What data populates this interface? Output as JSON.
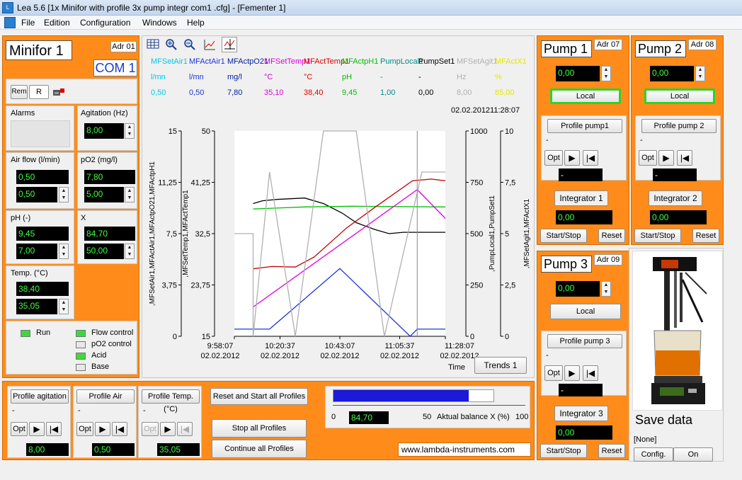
{
  "window": {
    "title": "Lea 5.6 [1x Minifor with profile 3x pump integr com1 .cfg] - [Fementer 1]"
  },
  "menu": [
    "File",
    "Edition",
    "Configuration",
    "Windows",
    "Help"
  ],
  "minifor": {
    "title": "Minifor 1",
    "adr": "Adr 01",
    "com": "COM 1",
    "tabs": [
      "Rem",
      "R"
    ],
    "alarms_label": "Alarms",
    "agitation": {
      "label": "Agitation (Hz)",
      "value": "8,00"
    },
    "airflow": {
      "label": "Air flow (l/min)",
      "actual": "0,50",
      "set": "0,50"
    },
    "po2": {
      "label": "pO2 (mg/l)",
      "actual": "7,80",
      "set": "5,00"
    },
    "ph": {
      "label": "pH (-)",
      "actual": "9,45",
      "set": "7,00"
    },
    "x": {
      "label": "X",
      "actual": "84,70",
      "set": "50,00"
    },
    "temp": {
      "label": "Temp. (°C)",
      "actual": "38,40",
      "set": "35,05"
    },
    "run": "Run",
    "status": [
      {
        "label": "Flow control",
        "on": true
      },
      {
        "label": "pO2 control",
        "on": false
      },
      {
        "label": "Acid",
        "on": true
      },
      {
        "label": "Base",
        "on": false
      }
    ]
  },
  "trend": {
    "channels": [
      {
        "name": "MFSetAir1",
        "unit": "l/mn",
        "value": "0,50",
        "color": "#00c8e6"
      },
      {
        "name": "MFActAir1",
        "unit": "l/mn",
        "value": "0,50",
        "color": "#1b36e0"
      },
      {
        "name": "MFActpO21",
        "unit": "mg/l",
        "value": "7,80",
        "color": "#001f9f"
      },
      {
        "name": "MFSetTemp1",
        "unit": "°C",
        "value": "35,10",
        "color": "#e000e0"
      },
      {
        "name": "MFActTemp1",
        "unit": "°C",
        "value": "38,40",
        "color": "#e00000"
      },
      {
        "name": "MFActpH1",
        "unit": "pH",
        "value": "9,45",
        "color": "#00c000"
      },
      {
        "name": "PumpLocal1",
        "unit": "-",
        "value": "1,00",
        "color": "#008b8b"
      },
      {
        "name": "PumpSet1",
        "unit": "-",
        "value": "0,00",
        "color": "#000000"
      },
      {
        "name": "MFSetAgit1",
        "unit": "Hz",
        "value": "8,00",
        "color": "#b0b0b0"
      },
      {
        "name": "MFActX1",
        "unit": "%",
        "value": "85,00",
        "color": "#e6e600"
      }
    ],
    "timestamp": "02.02.201211:28:07",
    "button": "Trends 1",
    "time_label": "Time",
    "chart_data": {
      "type": "line",
      "axes": {
        "y1": {
          "label": ",MFSetAir1,MFActAir1,MFActpO21,MFActpH1",
          "ticks": [
            "15",
            "11,25",
            "7,5",
            "3,75",
            "0"
          ],
          "range": [
            0,
            15
          ]
        },
        "y2": {
          "label": ",MFSetTemp1,MFActTemp1",
          "ticks": [
            "50",
            "41,25",
            "32,5",
            "23,75",
            "15"
          ],
          "range": [
            15,
            50
          ]
        },
        "y3": {
          "label": ",PumpLocal1,PumpSet1",
          "ticks": [
            "1000",
            "750",
            "500",
            "250",
            "0"
          ],
          "range": [
            0,
            1000
          ]
        },
        "y4": {
          "label": ",MFSetAgit1,MFActX1",
          "ticks": [
            "10",
            "7,5",
            "5",
            "2,5",
            "0"
          ],
          "range": [
            0,
            10
          ]
        }
      },
      "x_ticks": [
        {
          "time": "9:58:07",
          "date": "02.02.2012"
        },
        {
          "time": "10:20:37",
          "date": "02.02.2012"
        },
        {
          "time": "10:43:07",
          "date": "02.02.2012"
        },
        {
          "time": "11:05:37",
          "date": "02.02.2012"
        },
        {
          "time": "11:28:07",
          "date": "02.02.2012"
        }
      ],
      "x_range_min": [
        0,
        90
      ],
      "series": [
        {
          "name": "MFActpO21",
          "axis": "y1",
          "color": "#000000",
          "points": [
            [
              8,
              9.7
            ],
            [
              12,
              9.9
            ],
            [
              18,
              10.0
            ],
            [
              30,
              10.1
            ],
            [
              38,
              9.7
            ],
            [
              46,
              9.0
            ],
            [
              52,
              8.3
            ],
            [
              60,
              7.8
            ],
            [
              66,
              7.5
            ],
            [
              72,
              7.6
            ],
            [
              90,
              7.6
            ]
          ]
        },
        {
          "name": "MFActpH1",
          "axis": "y1",
          "color": "#00c000",
          "points": [
            [
              8,
              9.3
            ],
            [
              30,
              9.45
            ],
            [
              50,
              9.5
            ],
            [
              90,
              9.45
            ]
          ]
        },
        {
          "name": "MFActTemp1",
          "axis": "y2",
          "color": "#c00000",
          "points": [
            [
              8,
              26.5
            ],
            [
              16,
              26.9
            ],
            [
              26,
              26.8
            ],
            [
              34,
              28.5
            ],
            [
              48,
              33.5
            ],
            [
              60,
              37.0
            ],
            [
              76,
              41.5
            ],
            [
              84,
              41.8
            ],
            [
              90,
              41.5
            ]
          ]
        },
        {
          "name": "MFSetTemp1",
          "axis": "y2",
          "color": "#e000e0",
          "points": [
            [
              8,
              20.0
            ],
            [
              78,
              40.0
            ],
            [
              90,
              35.1
            ]
          ]
        },
        {
          "name": "PumpSet1",
          "axis": "y3",
          "color": "#1b36e0",
          "points": [
            [
              0,
              35
            ],
            [
              15,
              35
            ],
            [
              15,
              35
            ],
            [
              45,
              330
            ],
            [
              75,
              0
            ],
            [
              78,
              35
            ],
            [
              90,
              35
            ]
          ]
        },
        {
          "name": "MFSetAgit1",
          "axis": "y4",
          "color": "#b0b0b0",
          "points": [
            [
              0,
              5
            ],
            [
              8,
              5
            ],
            [
              8,
              0
            ],
            [
              15,
              8
            ],
            [
              26,
              0
            ],
            [
              38,
              10
            ],
            [
              52,
              10
            ],
            [
              64,
              0
            ],
            [
              80,
              8
            ],
            [
              90,
              8
            ]
          ]
        }
      ]
    }
  },
  "profiles": [
    {
      "label": "Profile agitation",
      "sub": "-",
      "value": "8,00"
    },
    {
      "label": "Profile Air",
      "sub": "-",
      "value": "0,50"
    },
    {
      "label": "Profile Temp. (°C)",
      "sub": "-",
      "value": "35,05"
    }
  ],
  "opt_label": "Opt",
  "profile_buttons": {
    "reset_start": "Reset and Start all Profiles",
    "stop": "Stop all Profiles",
    "continue": "Continue all Profiles"
  },
  "balance": {
    "value": "84,70",
    "percent": 0.847,
    "ticks": [
      "0",
      "50",
      "100"
    ],
    "label": "Aktual balance X (%)"
  },
  "website": "www.lambda-instruments.com",
  "pumps": [
    {
      "title": "Pump 1",
      "adr": "Adr 07",
      "value": "0,00",
      "mode": "Local",
      "profile": "Profile pump1",
      "sub": "-",
      "display": "-",
      "integrator": "Integrator 1",
      "integrator_value": "0,00",
      "startstop": "Start/Stop",
      "reset": "Reset"
    },
    {
      "title": "Pump 2",
      "adr": "Adr 08",
      "value": "0,00",
      "mode": "Local",
      "profile": "Profile pump 2",
      "sub": "-",
      "display": "-",
      "integrator": "Integrator 2",
      "integrator_value": "0,00",
      "startstop": "Start/Stop",
      "reset": "Reset"
    },
    {
      "title": "Pump 3",
      "adr": "Adr 09",
      "value": "0,00",
      "mode": "Local",
      "profile": "Profile pump 3",
      "sub": "-",
      "display": "-",
      "integrator": "Integrator 3",
      "integrator_value": "0,00",
      "startstop": "Start/Stop",
      "reset": "Reset"
    }
  ],
  "save": {
    "title": "Save data",
    "file": "[None]",
    "config": "Config.",
    "on": "On"
  }
}
